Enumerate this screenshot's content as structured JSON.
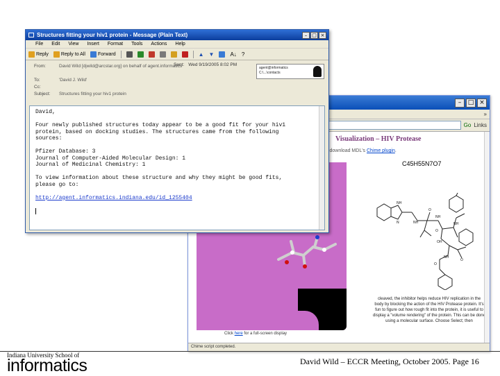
{
  "browser": {
    "links_label": "Links",
    "go_label": "Go",
    "page_heading": "Visualization – HIV Protease",
    "page_sub_prefix": "ed to download MDL's",
    "page_sub_link": "Chime plugin",
    "formula": "C45H55N7O7",
    "caption": "cleaved, the inhibitor helps reduce HIV replication in the body by blocking the action of the HIV Protease protein. It's fun to figure out how rough fit into the protein, it is useful to display a \"volume rendering\" of the protein. This can be done using a molecular surface. Choose Select; then",
    "full_link_prefix": "Click",
    "full_link_text": "here",
    "full_link_suffix": "for a full-screen display",
    "status": "Chime script completed."
  },
  "email": {
    "title": "Structures fitting your hiv1 protein - Message (Plain Text)",
    "menu": [
      "File",
      "Edit",
      "View",
      "Insert",
      "Format",
      "Tools",
      "Actions",
      "Help"
    ],
    "toolbar": {
      "reply": "Reply",
      "reply_all": "Reply to All",
      "forward": "Forward"
    },
    "headers": {
      "from_label": "From:",
      "from_value": "David Wild [djwild@arcstar.org] on behalf of agent.informatics",
      "to_label": "To:",
      "to_value": "'David J. Wild'",
      "cc_label": "Cc:",
      "cc_value": "",
      "subject_label": "Subject:",
      "subject_value": "Structures fitting your hiv1 protein",
      "sent_label": "Sent:",
      "sent_value": "Wed 9/19/2005 8:02 PM"
    },
    "contact_card": {
      "line1": "agent@informatics",
      "line2": "C:\\...\\contacts"
    },
    "body": {
      "greeting": "David,",
      "para1_l1": "Four newly published structures today appear to be a good fit for your hiv1",
      "para1_l2": "protein, based on docking studies. The structures came from the following",
      "para1_l3": "sources:",
      "src1": "Pfizer Database: 3",
      "src2": "Journal of Computer-Aided Molecular Design: 1",
      "src3": "Journal of Medicinal Chemistry: 1",
      "para2_l1": "To view information about these structure and why they might be good fits,",
      "para2_l2": "please go to:",
      "link": "http://agent.informatics.indiana.edu/id_1255404"
    }
  },
  "footer": {
    "school": "Indiana University School of",
    "informatics": "informatics",
    "caption": "David Wild – ECCR Meeting, October 2005. Page 16"
  },
  "colors": {
    "protein_surface": "#c86cc8",
    "titlebar": "#0b3d9c",
    "link": "#1a3acc"
  }
}
